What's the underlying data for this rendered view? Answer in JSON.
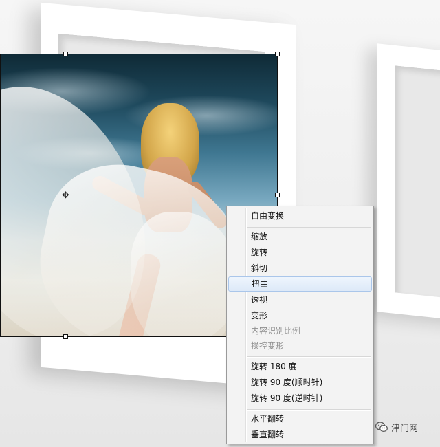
{
  "context_menu": {
    "items": [
      {
        "label": "自由变换",
        "enabled": true
      },
      {
        "label": "缩放",
        "enabled": true
      },
      {
        "label": "旋转",
        "enabled": true
      },
      {
        "label": "斜切",
        "enabled": true
      },
      {
        "label": "扭曲",
        "enabled": true,
        "highlighted": true
      },
      {
        "label": "透视",
        "enabled": true
      },
      {
        "label": "变形",
        "enabled": true
      },
      {
        "label": "内容识别比例",
        "enabled": false
      },
      {
        "label": "操控变形",
        "enabled": false
      },
      {
        "label": "旋转 180 度",
        "enabled": true
      },
      {
        "label": "旋转 90 度(顺时针)",
        "enabled": true
      },
      {
        "label": "旋转 90 度(逆时针)",
        "enabled": true
      },
      {
        "label": "水平翻转",
        "enabled": true
      },
      {
        "label": "垂直翻转",
        "enabled": true
      }
    ]
  },
  "watermark": {
    "text": "津门网",
    "icon": "wechat-icon"
  },
  "colors": {
    "menu_background": "#f3f3f3",
    "menu_highlight": "#dde9f8",
    "disabled_text": "#8f8f8f"
  }
}
